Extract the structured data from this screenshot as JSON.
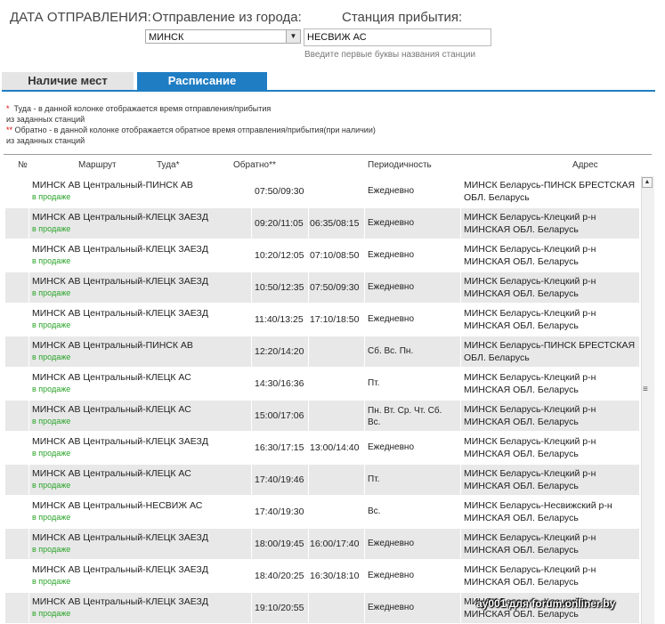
{
  "header": {
    "date_label": "ДАТА ОТПРАВЛЕНИЯ:",
    "from_label": "Отправление из города:",
    "to_label": "Станция прибытия:",
    "from_value": "МИНСК",
    "to_value": "НЕСВИЖ АС",
    "to_hint": "Введите первые буквы названия станции"
  },
  "tabs": [
    {
      "label": "Наличие мест"
    },
    {
      "label": "Расписание"
    }
  ],
  "notes": {
    "n1_star": "*",
    "n1_line1": "Туда - в данной колонке отображается время отправления/прибытия",
    "n1_line2": "из заданных станций",
    "n2_star": "**",
    "n2_line1": "Обратно - в данной колонке отображается обратное время отправления/прибытия(при наличии)",
    "n2_line2": "из заданных станций"
  },
  "columns": {
    "num": "№",
    "route": "Маршрут",
    "there": "Туда*",
    "back": "Обратно**",
    "period": "Периодичность",
    "address": "Адрес"
  },
  "status_text": "в продаже",
  "rows": [
    {
      "route": "МИНСК АВ Центральный-ПИНСК АВ",
      "there": "07:50/09:30",
      "back": "",
      "period": "Ежедневно",
      "addr1": "МИНСК Беларусь-ПИНСК БРЕСТСКАЯ",
      "addr2": "ОБЛ. Беларусь"
    },
    {
      "route": "МИНСК АВ Центральный-КЛЕЦК ЗАЕЗД",
      "there": "09:20/11:05",
      "back": "06:35/08:15",
      "period": "Ежедневно",
      "addr1": "МИНСК Беларусь-Клецкий р-н",
      "addr2": "МИНСКАЯ ОБЛ. Беларусь"
    },
    {
      "route": "МИНСК АВ Центральный-КЛЕЦК ЗАЕЗД",
      "there": "10:20/12:05",
      "back": "07:10/08:50",
      "period": "Ежедневно",
      "addr1": "МИНСК Беларусь-Клецкий р-н",
      "addr2": "МИНСКАЯ ОБЛ. Беларусь"
    },
    {
      "route": "МИНСК АВ Центральный-КЛЕЦК ЗАЕЗД",
      "there": "10:50/12:35",
      "back": "07:50/09:30",
      "period": "Ежедневно",
      "addr1": "МИНСК Беларусь-Клецкий р-н",
      "addr2": "МИНСКАЯ ОБЛ. Беларусь"
    },
    {
      "route": "МИНСК АВ Центральный-КЛЕЦК ЗАЕЗД",
      "there": "11:40/13:25",
      "back": "17:10/18:50",
      "period": "Ежедневно",
      "addr1": "МИНСК Беларусь-Клецкий р-н",
      "addr2": "МИНСКАЯ ОБЛ. Беларусь"
    },
    {
      "route": "МИНСК АВ Центральный-ПИНСК АВ",
      "there": "12:20/14:20",
      "back": "",
      "period": "Сб. Вс. Пн.",
      "addr1": "МИНСК Беларусь-ПИНСК БРЕСТСКАЯ",
      "addr2": "ОБЛ. Беларусь"
    },
    {
      "route": "МИНСК АВ Центральный-КЛЕЦК АС",
      "there": "14:30/16:36",
      "back": "",
      "period": "Пт.",
      "addr1": "МИНСК Беларусь-Клецкий р-н",
      "addr2": "МИНСКАЯ ОБЛ. Беларусь"
    },
    {
      "route": "МИНСК АВ Центральный-КЛЕЦК АС",
      "there": "15:00/17:06",
      "back": "",
      "period": "Пн. Вт. Ср. Чт. Сб. Вс.",
      "addr1": "МИНСК Беларусь-Клецкий р-н",
      "addr2": "МИНСКАЯ ОБЛ. Беларусь"
    },
    {
      "route": "МИНСК АВ Центральный-КЛЕЦК ЗАЕЗД",
      "there": "16:30/17:15",
      "back": "13:00/14:40",
      "period": "Ежедневно",
      "addr1": "МИНСК Беларусь-Клецкий р-н",
      "addr2": "МИНСКАЯ ОБЛ. Беларусь"
    },
    {
      "route": "МИНСК АВ Центральный-КЛЕЦК АС",
      "there": "17:40/19:46",
      "back": "",
      "period": "Пт.",
      "addr1": "МИНСК Беларусь-Клецкий р-н",
      "addr2": "МИНСКАЯ ОБЛ. Беларусь"
    },
    {
      "route": "МИНСК АВ Центральный-НЕСВИЖ АС",
      "there": "17:40/19:30",
      "back": "",
      "period": "Вс.",
      "addr1": "МИНСК Беларусь-Несвижский р-н",
      "addr2": "МИНСКАЯ ОБЛ. Беларусь"
    },
    {
      "route": "МИНСК АВ Центральный-КЛЕЦК ЗАЕЗД",
      "there": "18:00/19:45",
      "back": "16:00/17:40",
      "period": "Ежедневно",
      "addr1": "МИНСК Беларусь-Клецкий р-н",
      "addr2": "МИНСКАЯ ОБЛ. Беларусь"
    },
    {
      "route": "МИНСК АВ Центральный-КЛЕЦК ЗАЕЗД",
      "there": "18:40/20:25",
      "back": "16:30/18:10",
      "period": "Ежедневно",
      "addr1": "МИНСК Беларусь-Клецкий р-н",
      "addr2": "МИНСКАЯ ОБЛ. Беларусь"
    },
    {
      "route": "МИНСК АВ Центральный-КЛЕЦК ЗАЕЗД",
      "there": "19:10/20:55",
      "back": "",
      "period": "Ежедневно",
      "addr1": "МИНСК Беларусь-Клецкий р-н",
      "addr2": "МИНСКАЯ ОБЛ. Беларусь"
    }
  ],
  "watermark": "ay001 для forum.onliner.by"
}
